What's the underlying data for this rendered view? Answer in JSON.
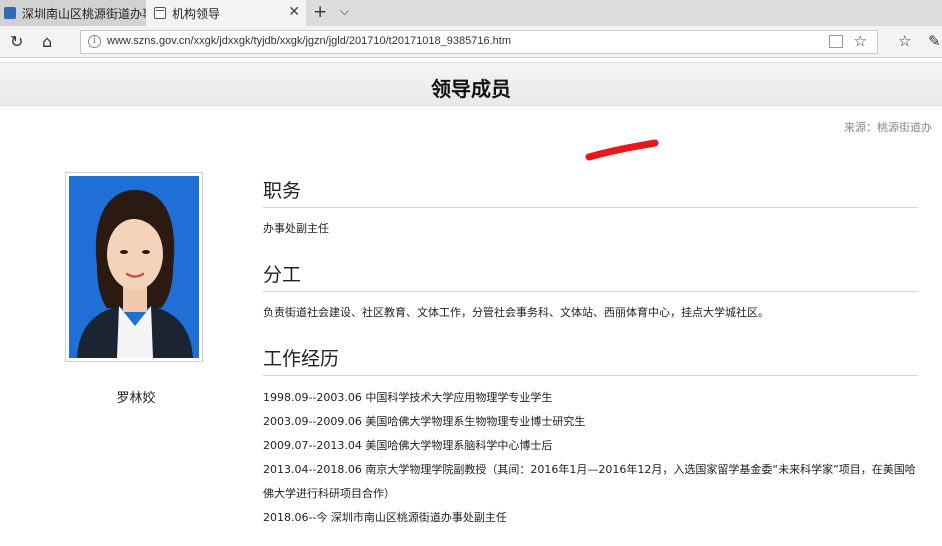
{
  "browser": {
    "tabs": [
      {
        "title": "深圳南山区桃源街道办事处"
      },
      {
        "title": "机构领导"
      }
    ],
    "url": "www.szns.gov.cn/xxgk/jdxxgk/tyjdb/xxgk/jgzn/jgld/201710/t20171018_9385716.htm"
  },
  "page": {
    "heading": "领导成员",
    "source": "来源：桃源街道办",
    "person_name": "罗林姣",
    "sections": {
      "duty": {
        "title": "职务",
        "text": "办事处副主任"
      },
      "division": {
        "title": "分工",
        "text": "负责街道社会建设、社区教育、文体工作，分管社会事务科、文体站、西丽体育中心，挂点大学城社区。"
      },
      "experience": {
        "title": "工作经历",
        "items": [
          "1998.09--2003.06 中国科学技术大学应用物理学专业学生",
          "2003.09--2009.06 美国哈佛大学物理系生物物理专业博士研究生",
          "2009.07--2013.04 美国哈佛大学物理系脑科学中心博士后",
          "2013.04--2018.06 南京大学物理学院副教授（其间：2016年1月—2016年12月，入选国家留学基金委“未来科学家”项目，在美国哈佛大学进行科研项目合作）",
          "2018.06--今 深圳市南山区桃源街道办事处副主任"
        ]
      }
    }
  },
  "colors": {
    "photo_background": "#1f6fd6",
    "annotation_red": "#e8191b"
  },
  "icons": [
    "page-icon",
    "close-icon",
    "plus-icon",
    "chevron-down-icon",
    "refresh-icon",
    "home-icon",
    "info-icon",
    "reading-view-icon",
    "star-icon",
    "favorites-icon",
    "pen-icon"
  ]
}
